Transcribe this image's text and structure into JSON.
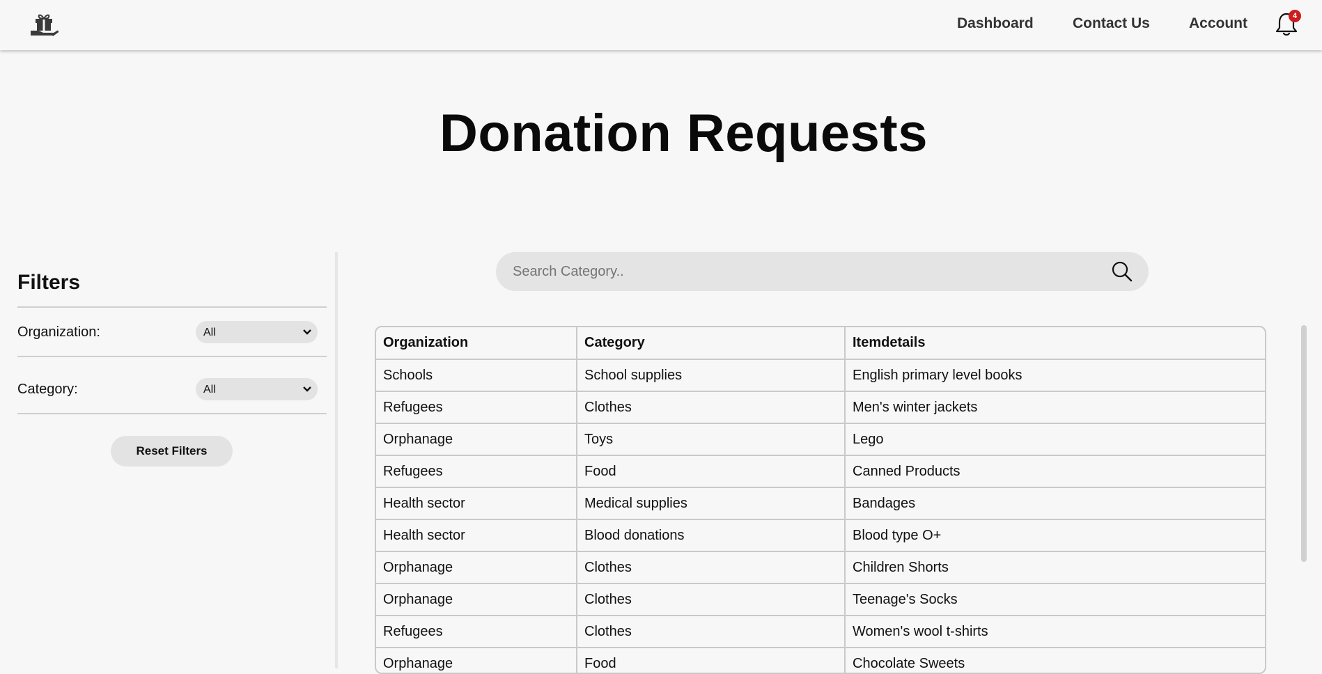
{
  "nav": {
    "logo_icon": "gift-hand-icon",
    "links": [
      "Dashboard",
      "Contact Us",
      "Account"
    ],
    "notification_icon": "bell-icon",
    "notification_count": "4"
  },
  "page": {
    "title": "Donation Requests"
  },
  "filters": {
    "heading": "Filters",
    "organization_label": "Organization:",
    "organization_value": "All",
    "category_label": "Category:",
    "category_value": "All",
    "reset_label": "Reset Filters"
  },
  "search": {
    "placeholder": "Search Category..",
    "icon": "search-icon"
  },
  "table": {
    "headers": [
      "Organization",
      "Category",
      "Itemdetails"
    ],
    "rows": [
      [
        "Schools",
        "School supplies",
        "English primary level books"
      ],
      [
        "Refugees",
        "Clothes",
        "Men's winter jackets"
      ],
      [
        "Orphanage",
        "Toys",
        "Lego"
      ],
      [
        "Refugees",
        "Food",
        "Canned Products"
      ],
      [
        "Health sector",
        "Medical supplies",
        "Bandages"
      ],
      [
        "Health sector",
        "Blood donations",
        "Blood type O+"
      ],
      [
        "Orphanage",
        "Clothes",
        "Children Shorts"
      ],
      [
        "Orphanage",
        "Clothes",
        "Teenage's Socks"
      ],
      [
        "Refugees",
        "Clothes",
        "Women's wool t-shirts"
      ],
      [
        "Orphanage",
        "Food",
        "Chocolate Sweets"
      ]
    ]
  },
  "colors": {
    "badge": "#cc1c1c",
    "background": "#f7f7f7",
    "control_fill": "#e3e3e3"
  }
}
